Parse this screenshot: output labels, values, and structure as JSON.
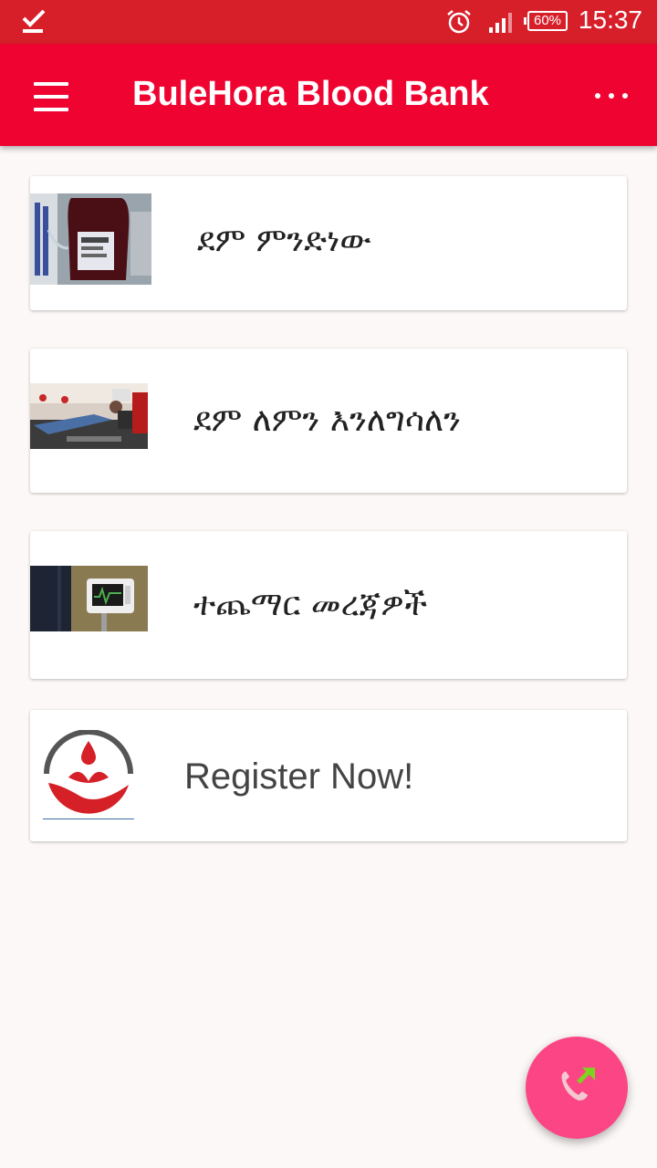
{
  "status_bar": {
    "time": "15:37",
    "battery": "60%",
    "icons": [
      "check-icon",
      "alarm-icon",
      "signal-icon",
      "battery-icon"
    ]
  },
  "app_bar": {
    "title": "BuleHora Blood Bank",
    "icons": [
      "menu-icon",
      "overflow-menu-icon"
    ],
    "color": "#ef0431"
  },
  "cards": [
    {
      "label": "ደም ምንድነው",
      "image": "blood-bag-photo"
    },
    {
      "label": "ደም ለምን እንለግሳለን",
      "image": "blood-donors-photo"
    },
    {
      "label": "ተጨማር መረጃዎች",
      "image": "medical-monitor-photo"
    },
    {
      "label": "Register Now!",
      "image": "blood-bank-logo"
    }
  ],
  "fab": {
    "icon": "phone-call-icon",
    "color": "#fc4585"
  }
}
